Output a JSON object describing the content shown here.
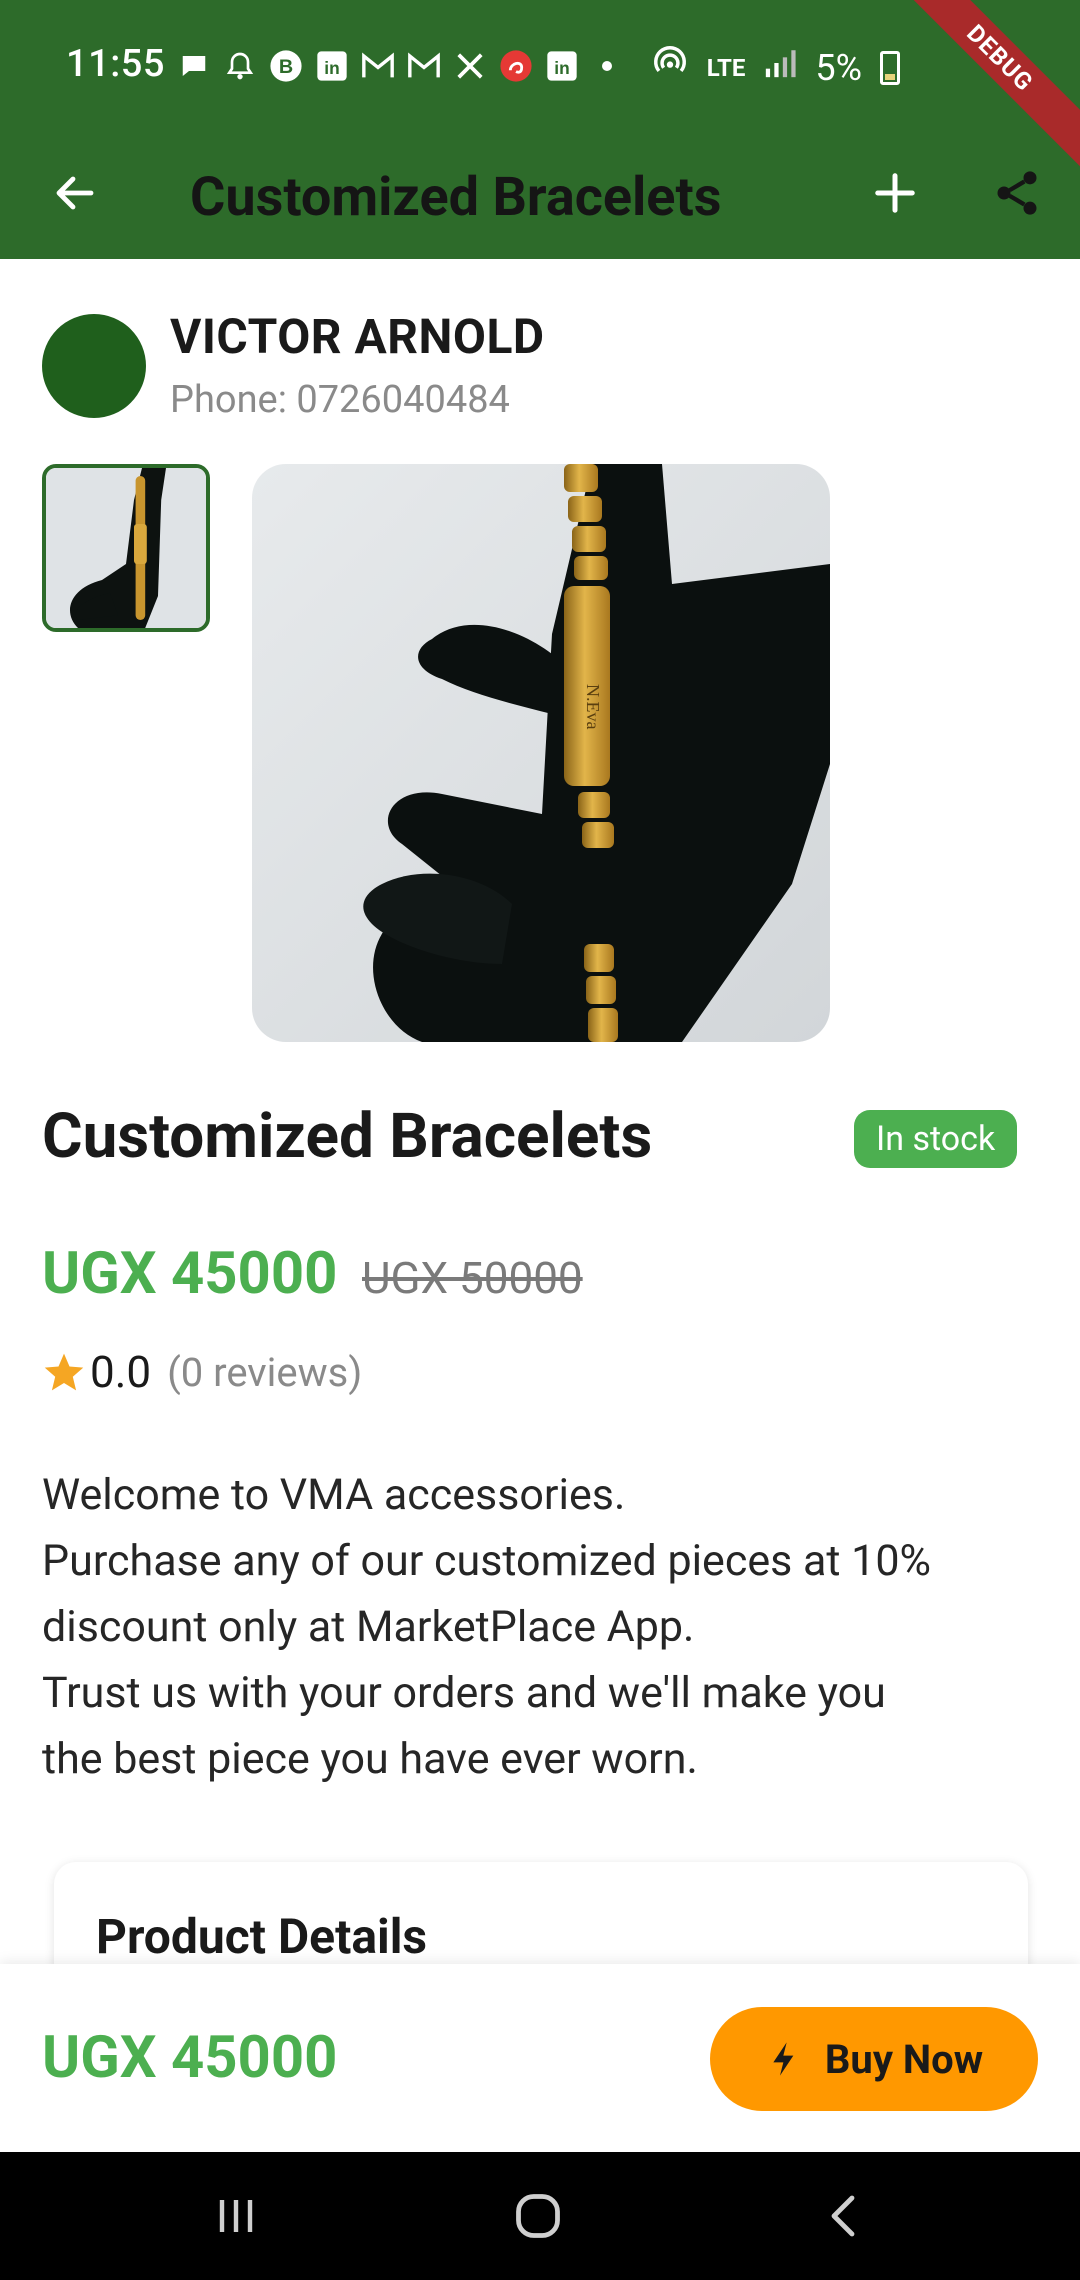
{
  "status_bar": {
    "time": "11:55",
    "battery": "5%",
    "network": "LTE"
  },
  "debug_banner": "DEBUG",
  "app_bar": {
    "title": "Customized Bracelets"
  },
  "seller": {
    "name": "VICTOR ARNOLD",
    "phone": "Phone: 0726040484"
  },
  "product": {
    "title": "Customized Bracelets",
    "stock_status": "In stock",
    "price": "UGX 45000",
    "old_price": "UGX 50000",
    "rating": "0.0",
    "reviews": "(0 reviews)",
    "description_lines": [
      "Welcome to VMA accessories.",
      "Purchase any of our customized pieces at 10%",
      "discount only at MarketPlace App.",
      "Trust us with your orders and we'll make you",
      "the best piece you have ever worn."
    ],
    "details_heading": "Product Details"
  },
  "buy_bar": {
    "price": "UGX 45000",
    "button_label": "Buy Now"
  },
  "colors": {
    "primary_green": "#2d6b2a",
    "price_green": "#4caf50",
    "buy_orange": "#ff9800",
    "star": "#f5a623"
  },
  "icons": {
    "back": "arrow-left-icon",
    "add": "plus-icon",
    "share": "share-icon",
    "star": "star-icon",
    "bolt": "bolt-icon"
  }
}
